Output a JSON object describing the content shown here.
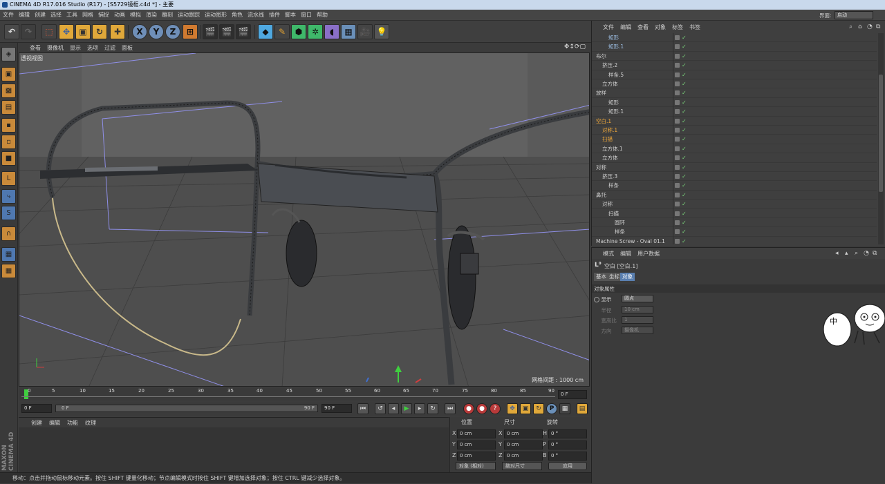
{
  "window_title": "CINEMA 4D R17.016 Studio (R17) - [S5729镜框.c4d *] - 主要",
  "menu": [
    "文件",
    "编辑",
    "创建",
    "选择",
    "工具",
    "网格",
    "捕捉",
    "动画",
    "模拟",
    "渲染",
    "雕刻",
    "运动跟踪",
    "运动图形",
    "角色",
    "流水线",
    "插件",
    "脚本",
    "窗口",
    "帮助"
  ],
  "layout": {
    "label": "界面:",
    "value": "启动"
  },
  "toolbar_icons": [
    "undo-icon",
    "redo-icon",
    "live-select-icon",
    "move-icon",
    "scale-icon",
    "rotate-icon",
    "recent-tool-icon",
    "x-axis-icon",
    "y-axis-icon",
    "z-axis-icon",
    "coordinate-system-icon",
    "render-view-icon",
    "render-picture-viewer-icon",
    "edit-render-settings-icon",
    "cube-icon",
    "pen-icon",
    "subdivision-icon",
    "cloner-icon",
    "deformer-icon",
    "floor-icon",
    "camera-icon",
    "light-icon"
  ],
  "axes": {
    "x": "X",
    "y": "Y",
    "z": "Z"
  },
  "viewport": {
    "menu": [
      "查看",
      "摄像机",
      "显示",
      "选项",
      "过滤",
      "面板"
    ],
    "label": "透视视图",
    "grid_spacing": "网格间距 : 1000 cm"
  },
  "timeline": {
    "ticks": [
      "0",
      "5",
      "10",
      "15",
      "20",
      "25",
      "30",
      "35",
      "40",
      "45",
      "50",
      "55",
      "60",
      "65",
      "70",
      "75",
      "80",
      "85",
      "90"
    ],
    "frame_field": "0 F",
    "start_field": "0 F",
    "slider_start": "0 F",
    "slider_end": "90 F",
    "end_field": "90 F",
    "key_p": "P"
  },
  "material_menu": [
    "创建",
    "编辑",
    "功能",
    "纹理"
  ],
  "coords": {
    "headers": [
      "位置",
      "尺寸",
      "旋转"
    ],
    "rows": [
      {
        "axis": "X",
        "pos": "0 cm",
        "size_axis": "X",
        "size": "0 cm",
        "rot_axis": "H",
        "rot": "0 °"
      },
      {
        "axis": "Y",
        "pos": "0 cm",
        "size_axis": "Y",
        "size": "0 cm",
        "rot_axis": "P",
        "rot": "0 °"
      },
      {
        "axis": "Z",
        "pos": "0 cm",
        "size_axis": "Z",
        "size": "0 cm",
        "rot_axis": "B",
        "rot": "0 °"
      }
    ],
    "mode": "对象 (相对)",
    "size_mode": "绝对尺寸",
    "apply": "应用"
  },
  "maxon": "MAXON CINEMA 4D",
  "status": "移动：点击并拖动鼠标移动元素。按住 SHIFT 键量化移动；节点编辑模式时按住 SHIFT 键增加选择对象；按住 CTRL 键减少选择对象。",
  "object_manager": {
    "menu": [
      "文件",
      "编辑",
      "查看",
      "对象",
      "标签",
      "书签"
    ],
    "objects": [
      {
        "name": "矩形",
        "indent": 2,
        "color": "#9fc2e8"
      },
      {
        "name": "矩形.1",
        "indent": 2,
        "color": "#9fc2e8"
      },
      {
        "name": "布尔",
        "indent": 0,
        "color": "#cfcfcf"
      },
      {
        "name": "挤压.2",
        "indent": 1,
        "color": "#cfcfcf"
      },
      {
        "name": "样条.5",
        "indent": 2,
        "color": "#cfcfcf"
      },
      {
        "name": "立方体",
        "indent": 1,
        "color": "#cfcfcf"
      },
      {
        "name": "放样",
        "indent": 0,
        "color": "#cfcfcf"
      },
      {
        "name": "矩形",
        "indent": 2,
        "color": "#cfcfcf"
      },
      {
        "name": "矩形.1",
        "indent": 2,
        "color": "#cfcfcf"
      },
      {
        "name": "空白.1",
        "indent": 0,
        "color": "#f0a83a"
      },
      {
        "name": "对称.1",
        "indent": 1,
        "color": "#f0a83a"
      },
      {
        "name": "扫描",
        "indent": 1,
        "color": "#f0a83a"
      },
      {
        "name": "立方体.1",
        "indent": 1,
        "color": "#cfcfcf"
      },
      {
        "name": "立方体",
        "indent": 1,
        "color": "#cfcfcf"
      },
      {
        "name": "对称",
        "indent": 0,
        "color": "#cfcfcf"
      },
      {
        "name": "挤压.3",
        "indent": 1,
        "color": "#cfcfcf"
      },
      {
        "name": "样条",
        "indent": 2,
        "color": "#cfcfcf"
      },
      {
        "name": "鼻托",
        "indent": 0,
        "color": "#cfcfcf"
      },
      {
        "name": "对称",
        "indent": 1,
        "color": "#cfcfcf"
      },
      {
        "name": "扫描",
        "indent": 2,
        "color": "#cfcfcf"
      },
      {
        "name": "圆环",
        "indent": 3,
        "color": "#cfcfcf"
      },
      {
        "name": "样条",
        "indent": 3,
        "color": "#cfcfcf"
      },
      {
        "name": "Machine Screw - Oval 01.1",
        "indent": 0,
        "color": "#cfcfcf"
      }
    ]
  },
  "attributes": {
    "menu": [
      "模式",
      "编辑",
      "用户数据"
    ],
    "object_title": "空白 [空白.1]",
    "tabs": [
      "基本",
      "坐标",
      "对象"
    ],
    "section": "对象属性",
    "fields": [
      {
        "label": "显示",
        "value": "圆点",
        "enabled": true
      },
      {
        "label": "半径",
        "value": "10 cm",
        "enabled": false
      },
      {
        "label": "宽高比",
        "value": "1",
        "enabled": false
      },
      {
        "label": "方向",
        "value": "摄像机",
        "enabled": false
      }
    ]
  },
  "sticker": {
    "text": "中"
  }
}
